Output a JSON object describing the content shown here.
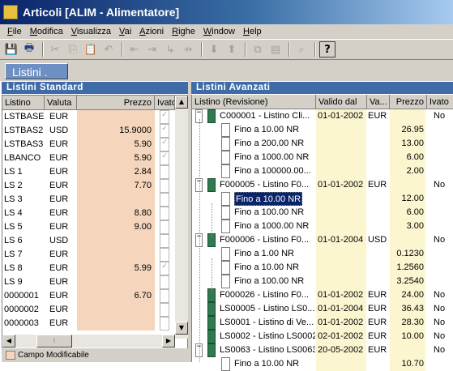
{
  "window": {
    "title": "Articoli [ALIM - Alimentatore]"
  },
  "menu": [
    "File",
    "Modifica",
    "Visualizza",
    "Vai",
    "Azioni",
    "Righe",
    "Window",
    "Help"
  ],
  "toolbar_icons": [
    "save-icon",
    "print-preview-icon",
    "cut-icon",
    "copy-icon",
    "paste-icon",
    "undo-icon",
    "insert-row-icon",
    "add-row-icon",
    "add-child-icon",
    "delete-row-icon",
    "move-down-icon",
    "move-up-icon",
    "copy-doc-icon",
    "paste-doc-icon",
    "search-icon",
    "help-icon"
  ],
  "tab": {
    "label": "Listini ."
  },
  "left": {
    "title": "Listini Standard",
    "columns": [
      "Listino",
      "Valuta",
      "Prezzo",
      "Ivato"
    ],
    "rows": [
      {
        "name": "LSTBASE",
        "val": "EUR",
        "price": "",
        "iv": true
      },
      {
        "name": "LSTBAS2",
        "val": "USD",
        "price": "15.9000",
        "iv": true
      },
      {
        "name": "LSTBAS3",
        "val": "EUR",
        "price": "5.90",
        "iv": true
      },
      {
        "name": "LBANCO",
        "val": "EUR",
        "price": "5.90",
        "iv": true
      },
      {
        "name": "LS 1",
        "val": "EUR",
        "price": "2.84",
        "iv": false
      },
      {
        "name": "LS 2",
        "val": "EUR",
        "price": "7.70",
        "iv": false
      },
      {
        "name": "LS 3",
        "val": "EUR",
        "price": "",
        "iv": false
      },
      {
        "name": "LS 4",
        "val": "EUR",
        "price": "8.80",
        "iv": false
      },
      {
        "name": "LS 5",
        "val": "EUR",
        "price": "9.00",
        "iv": false
      },
      {
        "name": "LS 6",
        "val": "USD",
        "price": "",
        "iv": false
      },
      {
        "name": "LS 7",
        "val": "EUR",
        "price": "",
        "iv": false
      },
      {
        "name": "LS 8",
        "val": "EUR",
        "price": "5.99",
        "iv": true
      },
      {
        "name": "LS 9",
        "val": "EUR",
        "price": "",
        "iv": false
      },
      {
        "name": "0000001",
        "val": "EUR",
        "price": "6.70",
        "iv": false
      },
      {
        "name": "0000002",
        "val": "EUR",
        "price": "",
        "iv": false
      },
      {
        "name": "0000003",
        "val": "EUR",
        "price": "",
        "iv": false
      }
    ],
    "legend": "Campo Modificabile",
    "legend_color": "#f5d6bc"
  },
  "right": {
    "title": "Listini Avanzati",
    "columns": [
      "Listino (Revisione)",
      "Valido dal",
      "Va...",
      "Prezzo",
      "Ivato"
    ],
    "rows": [
      {
        "lvl": 0,
        "tog": "-",
        "desc": "C000001 - Listino Cli...",
        "dal": "01-01-2002",
        "val": "EUR",
        "price": "",
        "iv": "No"
      },
      {
        "lvl": 1,
        "desc": "Fino a 10.00 NR",
        "price": "26.95"
      },
      {
        "lvl": 1,
        "desc": "Fino a 200.00 NR",
        "price": "13.00"
      },
      {
        "lvl": 1,
        "desc": "Fino a 1000.00 NR",
        "price": "6.00"
      },
      {
        "lvl": 1,
        "desc": "Fino a 100000.00...",
        "price": "2.00"
      },
      {
        "lvl": 0,
        "tog": "-",
        "desc": "F000005 - Listino F0...",
        "dal": "01-01-2002",
        "val": "EUR",
        "price": "",
        "iv": "No"
      },
      {
        "lvl": 1,
        "desc": "Fino a 10.00 NR",
        "price": "12.00",
        "selected": true
      },
      {
        "lvl": 1,
        "desc": "Fino a 100.00 NR",
        "price": "6.00"
      },
      {
        "lvl": 1,
        "desc": "Fino a 1000.00 NR",
        "price": "3.00"
      },
      {
        "lvl": 0,
        "tog": "-",
        "desc": "F000006 - Listino F0...",
        "dal": "01-01-2004",
        "val": "USD",
        "price": "",
        "iv": "No"
      },
      {
        "lvl": 1,
        "desc": "Fino a 1.00 NR",
        "price": "0.1230"
      },
      {
        "lvl": 1,
        "desc": "Fino a 10.00 NR",
        "price": "1.2560"
      },
      {
        "lvl": 1,
        "desc": "Fino a 100.00 NR",
        "price": "3.2540"
      },
      {
        "lvl": 0,
        "tog": "",
        "desc": "F000026 - Listino F0...",
        "dal": "01-01-2002",
        "val": "EUR",
        "price": "24.00",
        "iv": "No"
      },
      {
        "lvl": 0,
        "tog": "",
        "desc": "LS00005 - Listino LS0...",
        "dal": "01-01-2004",
        "val": "EUR",
        "price": "36.43",
        "iv": "No"
      },
      {
        "lvl": 0,
        "tog": "",
        "desc": "LS0001 - Listino di Ve...",
        "dal": "01-01-2002",
        "val": "EUR",
        "price": "28.30",
        "iv": "No"
      },
      {
        "lvl": 0,
        "tog": "",
        "desc": "LS0002 - Listino LS0002",
        "dal": "02-01-2002",
        "val": "EUR",
        "price": "10.00",
        "iv": "No"
      },
      {
        "lvl": 0,
        "tog": "-",
        "desc": "LS0063 - Listino LS0063",
        "dal": "20-05-2002",
        "val": "EUR",
        "price": "",
        "iv": "No"
      },
      {
        "lvl": 1,
        "desc": "Fino a 10.00 NR",
        "price": "10.70"
      }
    ]
  }
}
